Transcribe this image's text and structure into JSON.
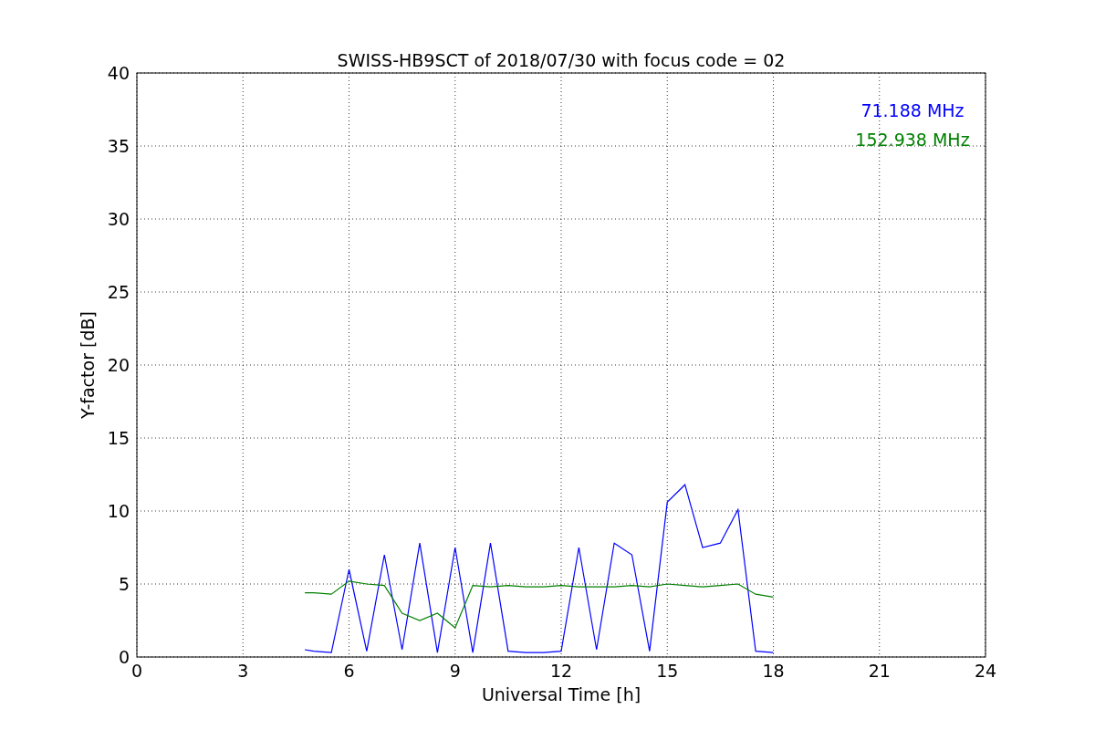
{
  "chart_data": {
    "type": "line",
    "title": "SWISS-HB9SCT of 2018/07/30 with focus code = 02",
    "xlabel": "Universal Time [h]",
    "ylabel": "Y-factor [dB]",
    "x": [
      4.75,
      5,
      5.5,
      6,
      6.5,
      7,
      7.5,
      8,
      8.5,
      9,
      9.5,
      10,
      10.5,
      11,
      11.5,
      12,
      12.5,
      13,
      13.5,
      14,
      14.5,
      15,
      15.5,
      16,
      16.5,
      17,
      17.5,
      18
    ],
    "series": [
      {
        "name": "71.188 MHz",
        "color": "#0000ff",
        "values": [
          0.5,
          0.4,
          0.3,
          6,
          0.4,
          7,
          0.5,
          7.8,
          0.3,
          7.5,
          0.3,
          7.8,
          0.4,
          0.3,
          0.3,
          0.4,
          7.5,
          0.5,
          7.8,
          7,
          0.4,
          10.6,
          11.8,
          7.5,
          7.8,
          10.1,
          0.4,
          0.3
        ]
      },
      {
        "name": "152.938 MHz",
        "color": "#008000",
        "values": [
          4.4,
          4.4,
          4.3,
          5.2,
          5,
          4.9,
          3,
          2.5,
          3,
          2,
          4.9,
          4.8,
          4.9,
          4.8,
          4.8,
          4.9,
          4.8,
          4.8,
          4.8,
          4.9,
          4.8,
          5,
          4.9,
          4.8,
          4.9,
          5,
          4.3,
          4.1
        ]
      }
    ],
    "xlim": [
      0,
      24
    ],
    "ylim": [
      0,
      40
    ],
    "xticks": [
      0,
      3,
      6,
      9,
      12,
      15,
      18,
      21,
      24
    ],
    "yticks": [
      0,
      5,
      10,
      15,
      20,
      25,
      30,
      35,
      40
    ],
    "grid": true
  }
}
